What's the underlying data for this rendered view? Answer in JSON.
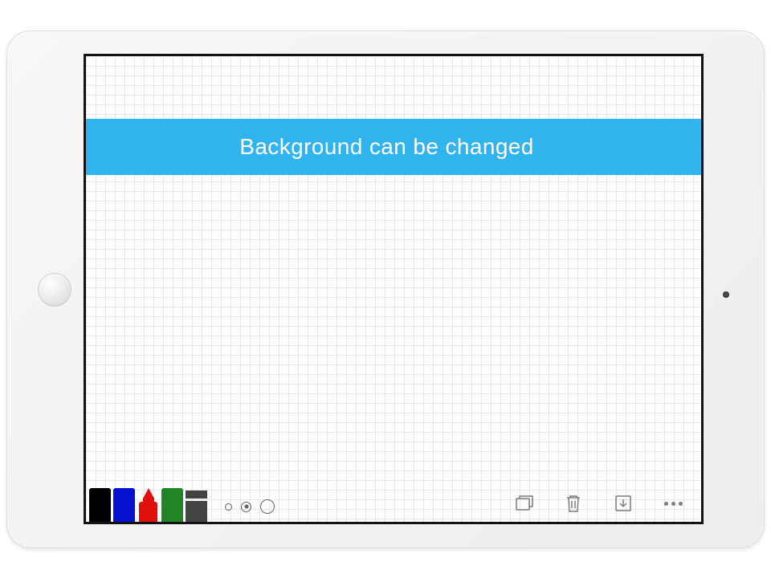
{
  "banner": {
    "text": "Background can be changed"
  },
  "tools": {
    "markers": [
      {
        "name": "black",
        "color": "#000000"
      },
      {
        "name": "blue",
        "color": "#0810cf"
      },
      {
        "name": "red",
        "color": "#e20f0c"
      },
      {
        "name": "green",
        "color": "#218425"
      }
    ],
    "eraser": "eraser",
    "sizes": [
      "small",
      "medium",
      "large"
    ],
    "selected_size": "medium"
  },
  "actions": {
    "pages": "pages",
    "trash": "trash",
    "export": "export",
    "more": "more"
  }
}
